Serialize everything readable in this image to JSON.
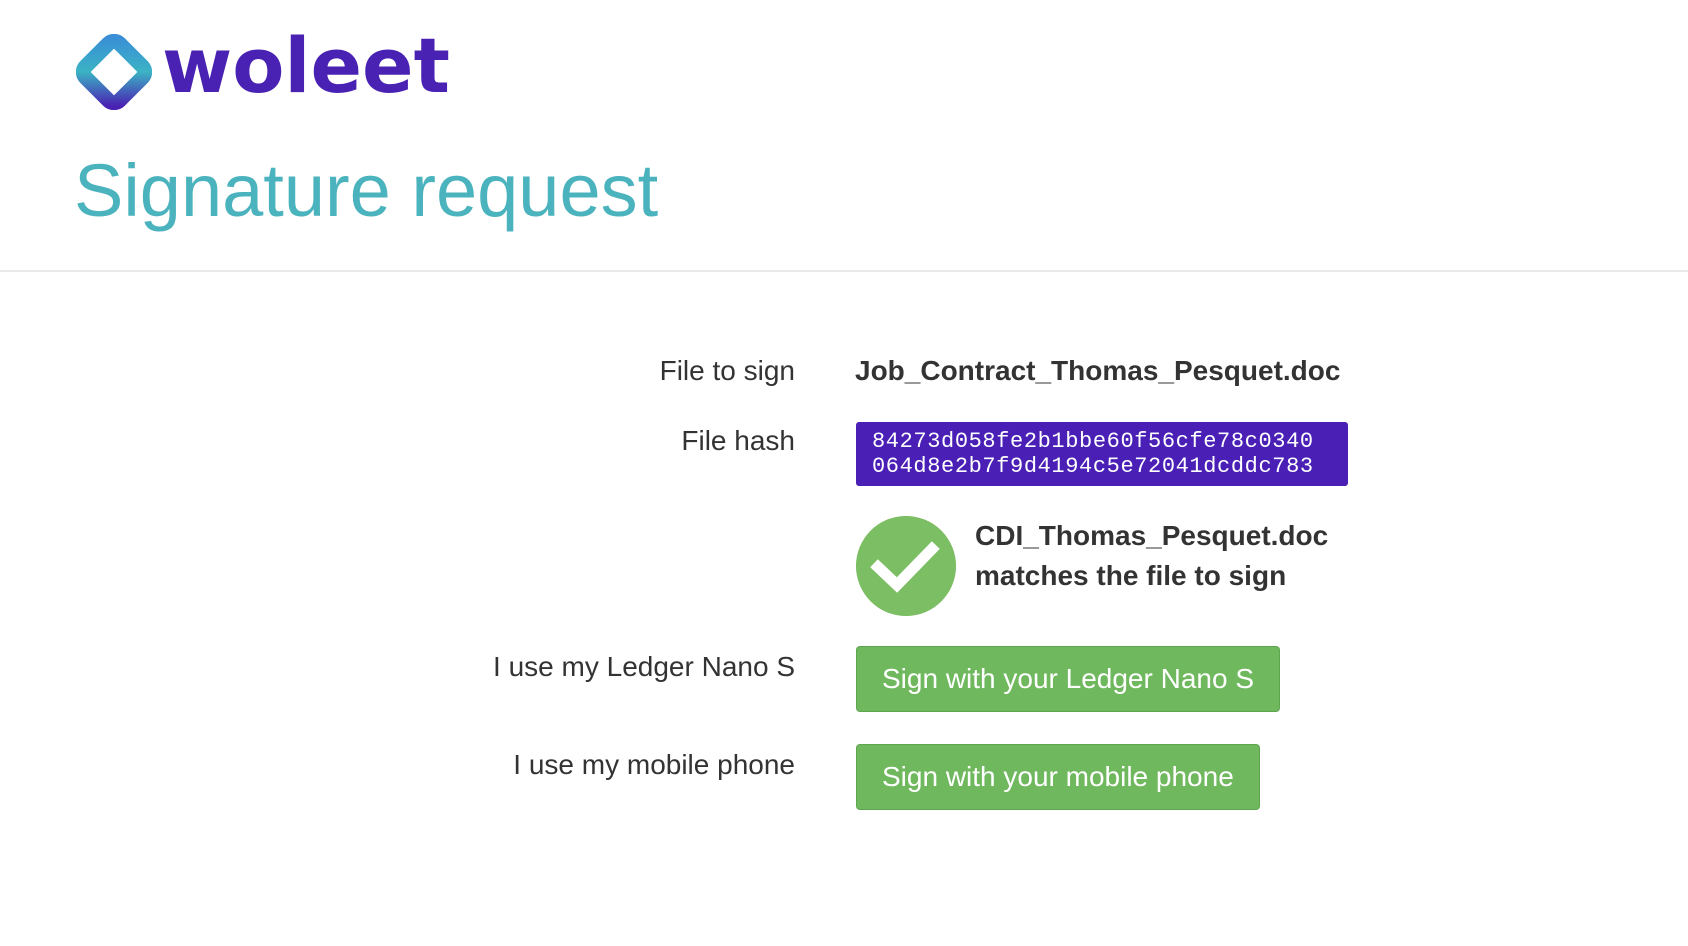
{
  "brand": {
    "name": "woleet",
    "logo_icon": "woleet-diamond-icon",
    "color": "#4a22b3"
  },
  "page_title": "Signature request",
  "form": {
    "file_to_sign_label": "File to sign",
    "file_to_sign_value": "Job_Contract_Thomas_Pesquet.doc",
    "file_hash_label": "File hash",
    "file_hash_lines": [
      "84273d058fe2b1bbe60f56cfe78c0340",
      "064d8e2b7f9d4194c5e72041dcddc783"
    ],
    "match": {
      "icon": "check-icon",
      "line1": "CDI_Thomas_Pesquet.doc",
      "line2": "matches the file to sign"
    },
    "ledger_label": "I use my Ledger Nano S",
    "ledger_button": "Sign with your Ledger Nano S",
    "mobile_label": "I use my mobile phone",
    "mobile_button": "Sign with your mobile phone"
  },
  "colors": {
    "title": "#4bb3bd",
    "hash_background": "#4a1fb6",
    "button_green": "#6fb85e",
    "check_green": "#7cbe63"
  }
}
